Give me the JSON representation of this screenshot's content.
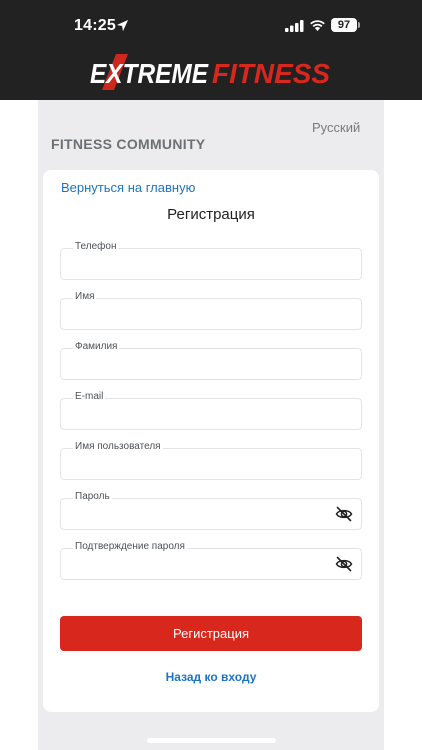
{
  "status_bar": {
    "time": "14:25",
    "battery": "97"
  },
  "header": {
    "logo_part1": "EXTREME",
    "logo_part2": "FITNESS",
    "logo_color_white": "#ffffff",
    "logo_color_red": "#d8281e"
  },
  "page": {
    "language": "Русский",
    "community_title": "FITNESS COMMUNITY"
  },
  "card": {
    "back_link": "Вернуться на главную",
    "title": "Регистрация",
    "fields": [
      {
        "label": "Телефон",
        "value": ""
      },
      {
        "label": "Имя",
        "value": ""
      },
      {
        "label": "Фамилия",
        "value": ""
      },
      {
        "label": "E-mail",
        "value": ""
      },
      {
        "label": "Имя пользователя",
        "value": ""
      },
      {
        "label": "Пароль",
        "value": "",
        "icon": "eye-slash-icon"
      },
      {
        "label": "Подтверждение пароля",
        "value": "",
        "icon": "eye-slash-icon"
      }
    ],
    "submit_label": "Регистрация",
    "login_link": "Назад ко входу"
  },
  "colors": {
    "accent_red": "#d8281e",
    "link_blue": "#1d75c0",
    "header_dark": "#222222"
  }
}
